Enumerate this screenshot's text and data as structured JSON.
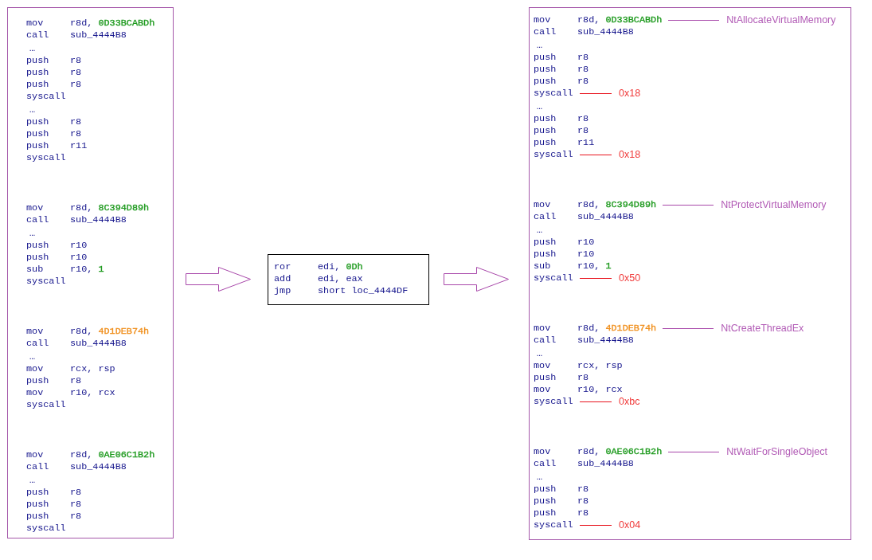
{
  "original_listing": {
    "blocks": [
      {
        "lines": [
          {
            "kind": "instruction",
            "mnemonic": "mov",
            "operands": "r8d,",
            "constant": {
              "text": "0D33BCABDh",
              "color": "#1e9a1e"
            }
          },
          {
            "kind": "instruction",
            "mnemonic": "call",
            "operands": "sub_4444B8"
          },
          {
            "kind": "ellipsis",
            "text": "…"
          },
          {
            "kind": "instruction",
            "mnemonic": "push",
            "operands": "r8"
          },
          {
            "kind": "instruction",
            "mnemonic": "push",
            "operands": "r8"
          },
          {
            "kind": "instruction",
            "mnemonic": "push",
            "operands": "r8"
          },
          {
            "kind": "instruction",
            "mnemonic": "syscall"
          },
          {
            "kind": "ellipsis",
            "text": "…"
          },
          {
            "kind": "instruction",
            "mnemonic": "push",
            "operands": "r8"
          },
          {
            "kind": "instruction",
            "mnemonic": "push",
            "operands": "r8"
          },
          {
            "kind": "instruction",
            "mnemonic": "push",
            "operands": "r11"
          },
          {
            "kind": "instruction",
            "mnemonic": "syscall"
          }
        ]
      },
      {
        "lines": [
          {
            "kind": "instruction",
            "mnemonic": "mov",
            "operands": "r8d,",
            "constant": {
              "text": "8C394D89h",
              "color": "#1e9a1e"
            }
          },
          {
            "kind": "instruction",
            "mnemonic": "call",
            "operands": "sub_4444B8"
          },
          {
            "kind": "ellipsis",
            "text": "…"
          },
          {
            "kind": "instruction",
            "mnemonic": "push",
            "operands": "r10"
          },
          {
            "kind": "instruction",
            "mnemonic": "push",
            "operands": "r10"
          },
          {
            "kind": "instruction",
            "mnemonic": "sub",
            "operands": "r10,",
            "constant": {
              "text": "1",
              "color": "#1e9a1e"
            }
          },
          {
            "kind": "instruction",
            "mnemonic": "syscall"
          }
        ]
      },
      {
        "lines": [
          {
            "kind": "instruction",
            "mnemonic": "mov",
            "operands": "r8d,",
            "constant": {
              "text": "4D1DEB74h",
              "color": "#f0901e"
            }
          },
          {
            "kind": "instruction",
            "mnemonic": "call",
            "operands": "sub_4444B8"
          },
          {
            "kind": "ellipsis",
            "text": "…"
          },
          {
            "kind": "instruction",
            "mnemonic": "mov",
            "operands": "rcx, rsp"
          },
          {
            "kind": "instruction",
            "mnemonic": "push",
            "operands": "r8"
          },
          {
            "kind": "instruction",
            "mnemonic": "mov",
            "operands": "r10, rcx"
          },
          {
            "kind": "instruction",
            "mnemonic": "syscall"
          }
        ]
      },
      {
        "lines": [
          {
            "kind": "instruction",
            "mnemonic": "mov",
            "operands": "r8d,",
            "constant": {
              "text": "0AE06C1B2h",
              "color": "#1e9a1e"
            }
          },
          {
            "kind": "instruction",
            "mnemonic": "call",
            "operands": "sub_4444B8"
          },
          {
            "kind": "ellipsis",
            "text": "…"
          },
          {
            "kind": "instruction",
            "mnemonic": "push",
            "operands": "r8"
          },
          {
            "kind": "instruction",
            "mnemonic": "push",
            "operands": "r8"
          },
          {
            "kind": "instruction",
            "mnemonic": "push",
            "operands": "r8"
          },
          {
            "kind": "instruction",
            "mnemonic": "syscall"
          }
        ]
      }
    ]
  },
  "hash_routine": {
    "blocks": [
      {
        "lines": [
          {
            "kind": "instruction",
            "mnemonic": "ror",
            "operands": "edi,",
            "constant": {
              "text": "0Dh",
              "color": "#1e9a1e"
            }
          },
          {
            "kind": "instruction",
            "mnemonic": "add",
            "operands": "edi, eax"
          },
          {
            "kind": "instruction",
            "mnemonic": "jmp",
            "operands": "short loc_4444DF"
          }
        ]
      }
    ]
  },
  "annotated_listing": {
    "blocks": [
      {
        "lines": [
          {
            "kind": "instruction",
            "mnemonic": "mov",
            "operands": "r8d,",
            "constant": {
              "text": "0D33BCABDh",
              "color": "#1e9a1e"
            },
            "annotation": {
              "kind": "api_name",
              "text": "NtAllocateVirtualMemory"
            }
          },
          {
            "kind": "instruction",
            "mnemonic": "call",
            "operands": "sub_4444B8"
          },
          {
            "kind": "ellipsis",
            "text": "…"
          },
          {
            "kind": "instruction",
            "mnemonic": "push",
            "operands": "r8"
          },
          {
            "kind": "instruction",
            "mnemonic": "push",
            "operands": "r8"
          },
          {
            "kind": "instruction",
            "mnemonic": "push",
            "operands": "r8"
          },
          {
            "kind": "instruction",
            "mnemonic": "syscall",
            "annotation": {
              "kind": "syscall_number",
              "text": "0x18"
            }
          },
          {
            "kind": "ellipsis",
            "text": "…"
          },
          {
            "kind": "instruction",
            "mnemonic": "push",
            "operands": "r8"
          },
          {
            "kind": "instruction",
            "mnemonic": "push",
            "operands": "r8"
          },
          {
            "kind": "instruction",
            "mnemonic": "push",
            "operands": "r11"
          },
          {
            "kind": "instruction",
            "mnemonic": "syscall",
            "annotation": {
              "kind": "syscall_number",
              "text": "0x18"
            }
          }
        ]
      },
      {
        "lines": [
          {
            "kind": "instruction",
            "mnemonic": "mov",
            "operands": "r8d,",
            "constant": {
              "text": "8C394D89h",
              "color": "#1e9a1e"
            },
            "annotation": {
              "kind": "api_name",
              "text": "NtProtectVirtualMemory"
            }
          },
          {
            "kind": "instruction",
            "mnemonic": "call",
            "operands": "sub_4444B8"
          },
          {
            "kind": "ellipsis",
            "text": "…"
          },
          {
            "kind": "instruction",
            "mnemonic": "push",
            "operands": "r10"
          },
          {
            "kind": "instruction",
            "mnemonic": "push",
            "operands": "r10"
          },
          {
            "kind": "instruction",
            "mnemonic": "sub",
            "operands": "r10,",
            "constant": {
              "text": "1",
              "color": "#1e9a1e"
            }
          },
          {
            "kind": "instruction",
            "mnemonic": "syscall",
            "annotation": {
              "kind": "syscall_number",
              "text": "0x50"
            }
          }
        ]
      },
      {
        "lines": [
          {
            "kind": "instruction",
            "mnemonic": "mov",
            "operands": "r8d,",
            "constant": {
              "text": "4D1DEB74h",
              "color": "#f0901e"
            },
            "annotation": {
              "kind": "api_name",
              "text": "NtCreateThreadEx"
            }
          },
          {
            "kind": "instruction",
            "mnemonic": "call",
            "operands": "sub_4444B8"
          },
          {
            "kind": "ellipsis",
            "text": "…"
          },
          {
            "kind": "instruction",
            "mnemonic": "mov",
            "operands": "rcx, rsp"
          },
          {
            "kind": "instruction",
            "mnemonic": "push",
            "operands": "r8"
          },
          {
            "kind": "instruction",
            "mnemonic": "mov",
            "operands": "r10, rcx"
          },
          {
            "kind": "instruction",
            "mnemonic": "syscall",
            "annotation": {
              "kind": "syscall_number",
              "text": "0xbc"
            }
          }
        ]
      },
      {
        "lines": [
          {
            "kind": "instruction",
            "mnemonic": "mov",
            "operands": "r8d,",
            "constant": {
              "text": "0AE06C1B2h",
              "color": "#1e9a1e"
            },
            "annotation": {
              "kind": "api_name",
              "text": "NtWaitForSingleObject"
            }
          },
          {
            "kind": "instruction",
            "mnemonic": "call",
            "operands": "sub_4444B8"
          },
          {
            "kind": "ellipsis",
            "text": "…"
          },
          {
            "kind": "instruction",
            "mnemonic": "push",
            "operands": "r8"
          },
          {
            "kind": "instruction",
            "mnemonic": "push",
            "operands": "r8"
          },
          {
            "kind": "instruction",
            "mnemonic": "push",
            "operands": "r8"
          },
          {
            "kind": "instruction",
            "mnemonic": "syscall",
            "annotation": {
              "kind": "syscall_number",
              "text": "0x04"
            }
          }
        ]
      }
    ]
  }
}
